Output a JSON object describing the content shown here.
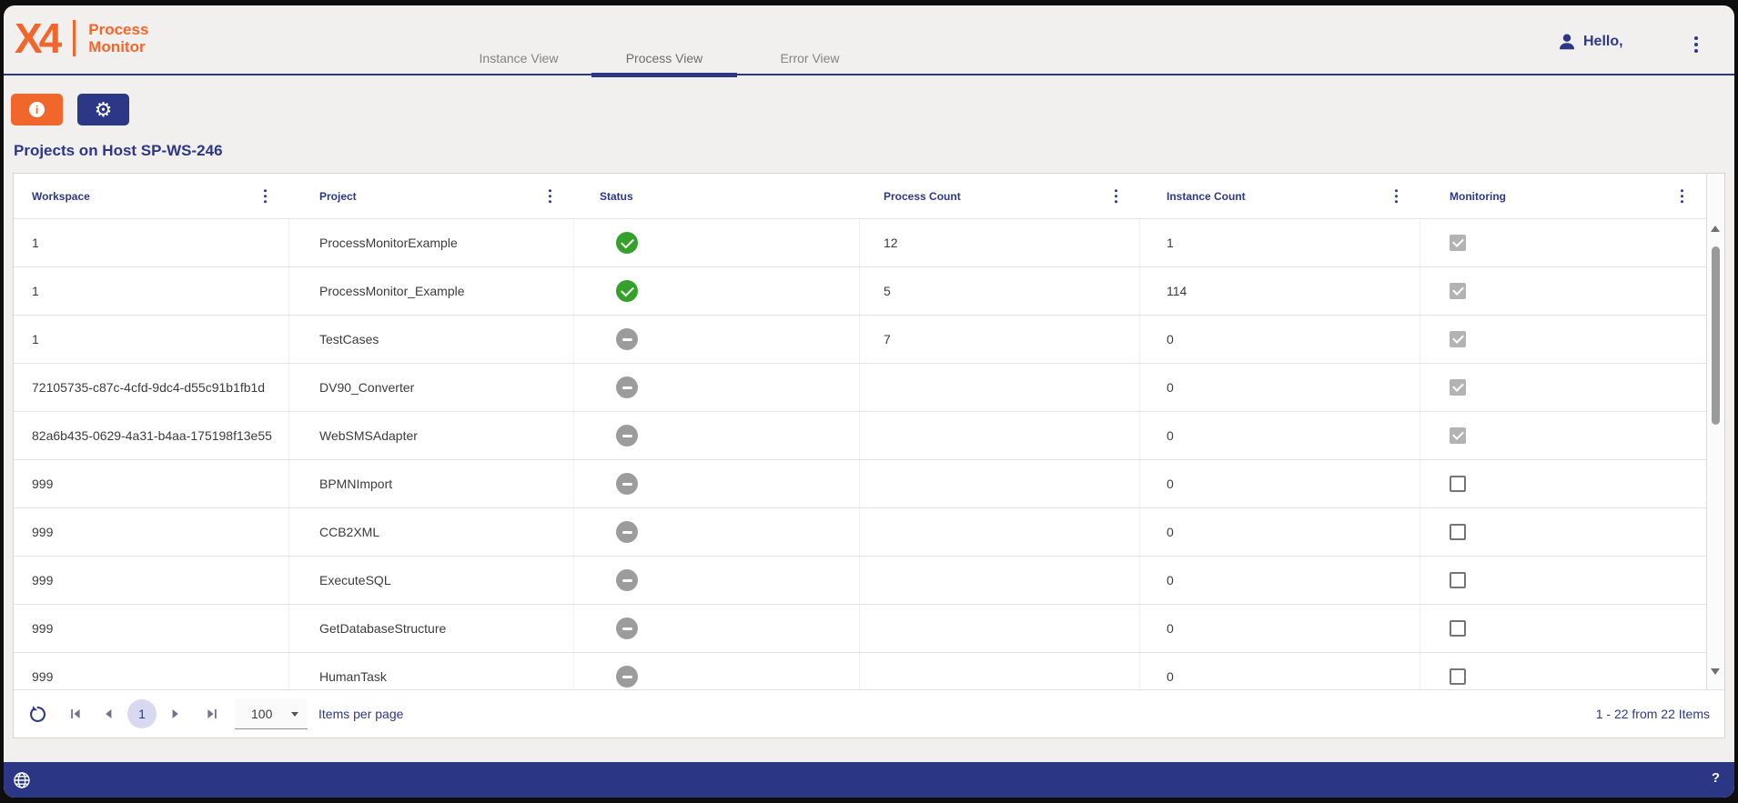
{
  "brand": {
    "logo": "X4",
    "product_line1": "Process",
    "product_line2": "Monitor"
  },
  "colors": {
    "accent_orange": "#f1672b",
    "accent_navy": "#2c3886",
    "status_active_green": "#35a02a",
    "status_inactive_gray": "#9c9c9c"
  },
  "header": {
    "tabs": [
      {
        "label": "Instance View",
        "active": false
      },
      {
        "label": "Process View",
        "active": true
      },
      {
        "label": "Error View",
        "active": false
      }
    ],
    "user_greeting": "Hello,"
  },
  "toolbar": {
    "buttons": [
      {
        "icon": "info-icon",
        "style": "orange"
      },
      {
        "icon": "gear-icon",
        "style": "navy"
      }
    ]
  },
  "page_title": "Projects on Host SP-WS-246",
  "table": {
    "columns": [
      {
        "label": "Workspace",
        "has_menu": true
      },
      {
        "label": "Project",
        "has_menu": true
      },
      {
        "label": "Status",
        "has_menu": false
      },
      {
        "label": "Process Count",
        "has_menu": true
      },
      {
        "label": "Instance Count",
        "has_menu": true
      },
      {
        "label": "Monitoring",
        "has_menu": true
      }
    ],
    "rows": [
      {
        "workspace": "1",
        "project": "ProcessMonitorExample",
        "status": "active",
        "process_count": "12",
        "instance_count": "1",
        "monitoring": true
      },
      {
        "workspace": "1",
        "project": "ProcessMonitor_Example",
        "status": "active",
        "process_count": "5",
        "instance_count": "114",
        "monitoring": true
      },
      {
        "workspace": "1",
        "project": "TestCases",
        "status": "inactive",
        "process_count": "7",
        "instance_count": "0",
        "monitoring": true
      },
      {
        "workspace": "72105735-c87c-4cfd-9dc4-d55c91b1fb1d",
        "project": "DV90_Converter",
        "status": "inactive",
        "process_count": "",
        "instance_count": "0",
        "monitoring": true
      },
      {
        "workspace": "82a6b435-0629-4a31-b4aa-175198f13e55",
        "project": "WebSMSAdapter",
        "status": "inactive",
        "process_count": "",
        "instance_count": "0",
        "monitoring": true
      },
      {
        "workspace": "999",
        "project": "BPMNImport",
        "status": "inactive",
        "process_count": "",
        "instance_count": "0",
        "monitoring": false
      },
      {
        "workspace": "999",
        "project": "CCB2XML",
        "status": "inactive",
        "process_count": "",
        "instance_count": "0",
        "monitoring": false
      },
      {
        "workspace": "999",
        "project": "ExecuteSQL",
        "status": "inactive",
        "process_count": "",
        "instance_count": "0",
        "monitoring": false
      },
      {
        "workspace": "999",
        "project": "GetDatabaseStructure",
        "status": "inactive",
        "process_count": "",
        "instance_count": "0",
        "monitoring": false
      },
      {
        "workspace": "999",
        "project": "HumanTask",
        "status": "inactive",
        "process_count": "",
        "instance_count": "0",
        "monitoring": false
      }
    ]
  },
  "paginator": {
    "current_page": "1",
    "page_size": "100",
    "page_size_label": "Items per page",
    "range_label": "1 - 22 from 22 Items",
    "icons": [
      "refresh-icon",
      "first-page-icon",
      "previous-page-icon",
      "next-page-icon",
      "last-page-icon",
      "dropdown-caret-icon"
    ]
  },
  "footer": {
    "help_label": "?",
    "icons": [
      "globe-icon"
    ]
  }
}
